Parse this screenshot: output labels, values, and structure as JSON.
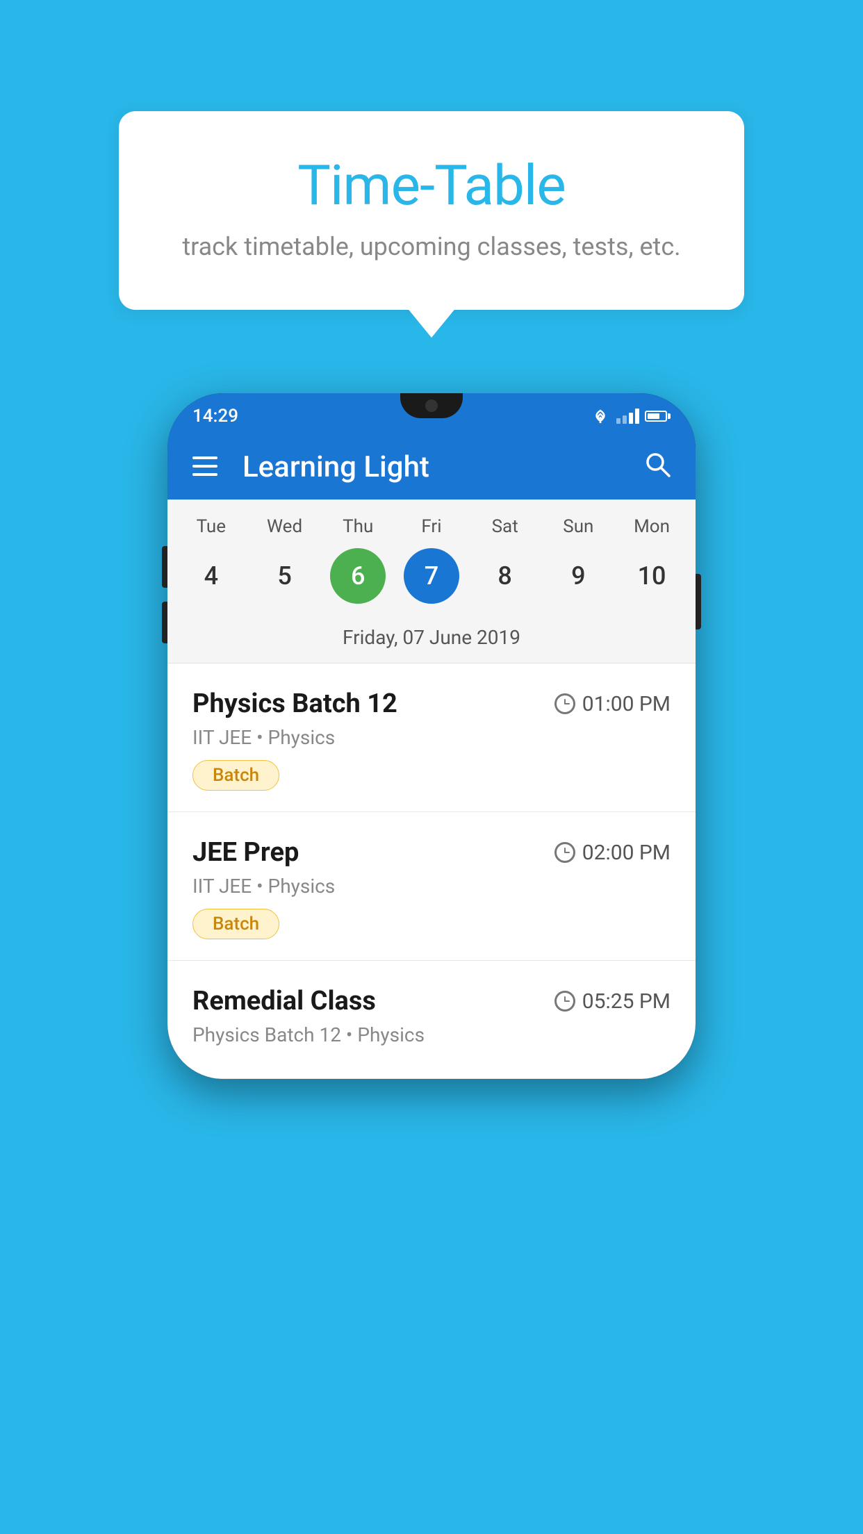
{
  "page": {
    "background_color": "#29B6E8"
  },
  "tooltip": {
    "title": "Time-Table",
    "subtitle": "track timetable, upcoming classes, tests, etc."
  },
  "phone": {
    "status_bar": {
      "time": "14:29"
    },
    "app_bar": {
      "title": "Learning Light"
    },
    "calendar": {
      "days": [
        "Tue",
        "Wed",
        "Thu",
        "Fri",
        "Sat",
        "Sun",
        "Mon"
      ],
      "dates": [
        "4",
        "5",
        "6",
        "7",
        "8",
        "9",
        "10"
      ],
      "today_index": 2,
      "selected_index": 3,
      "selected_date_label": "Friday, 07 June 2019"
    },
    "schedule": [
      {
        "title": "Physics Batch 12",
        "time": "01:00 PM",
        "subtitle": "IIT JEE • Physics",
        "badge": "Batch"
      },
      {
        "title": "JEE Prep",
        "time": "02:00 PM",
        "subtitle": "IIT JEE • Physics",
        "badge": "Batch"
      },
      {
        "title": "Remedial Class",
        "time": "05:25 PM",
        "subtitle": "Physics Batch 12 • Physics",
        "badge": ""
      }
    ]
  }
}
